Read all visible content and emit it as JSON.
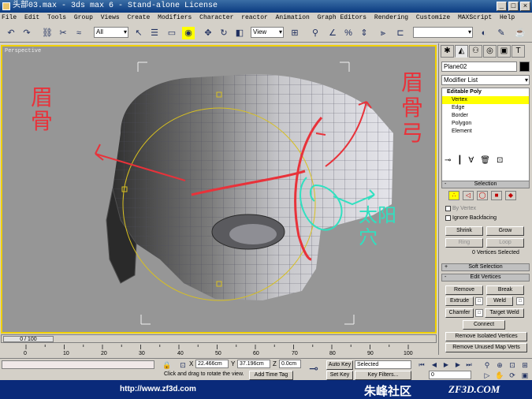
{
  "window": {
    "title": "头部03.max - 3ds max 6 - Stand-alone License"
  },
  "menu": [
    "File",
    "Edit",
    "Tools",
    "Group",
    "Views",
    "Create",
    "Modifiers",
    "Character",
    "reactor",
    "Animation",
    "Graph Editors",
    "Rendering",
    "Customize",
    "MAXScript",
    "Help"
  ],
  "toolbar": {
    "filter_value": "All",
    "view_value": "View"
  },
  "viewport": {
    "label": "Perspective",
    "annotations": {
      "brow_bone": "眉骨",
      "brow_ridge": "眉骨弓",
      "temple": "太阳穴"
    }
  },
  "command_panel": {
    "object_name": "Plane02",
    "modifier_list": "Modifier List",
    "stack": [
      "Editable Poly",
      "Vertex",
      "Edge",
      "Border",
      "Polygon",
      "Element"
    ],
    "selection": {
      "title": "Selection",
      "by_vertex": "By Vertex",
      "ignore_backfacing": "Ignore Backfacing",
      "shrink": "Shrink",
      "grow": "Grow",
      "ring": "Ring",
      "loop": "Loop",
      "status": "0 Vertices Selected"
    },
    "soft_selection": "Soft Selection",
    "edit_vertices": {
      "title": "Edit Vertices",
      "remove": "Remove",
      "break": "Break",
      "extrude": "Extrude",
      "weld": "Weld",
      "chamfer": "Chamfer",
      "target_weld": "Target Weld",
      "connect": "Connect",
      "remove_isolated": "Remove Isolated Vertices",
      "remove_unused": "Remove Unused Map Verts"
    }
  },
  "timeline": {
    "frame": "0 / 100",
    "ticks": [
      "0",
      "10",
      "20",
      "30",
      "40",
      "50",
      "60",
      "70",
      "80",
      "90",
      "100"
    ]
  },
  "status": {
    "x_label": "X",
    "x": "22.466cm",
    "y_label": "Y",
    "y": "37.196cm",
    "z_label": "Z",
    "z": "0.0cm",
    "prompt": "Click and drag to rotate the view.",
    "add_time_tag": "Add Time Tag",
    "auto_key": "Auto Key",
    "selected": "Selected",
    "set_key": "Set Key",
    "key_filters": "Key Filters...",
    "frame_field": "0"
  },
  "footer": {
    "url": "http://www.zf3d.com",
    "site_name": "朱峰社区",
    "brand": "ZF3D.COM"
  },
  "colors": {
    "viewport_bg": "#969696",
    "active_border": "#f0d000",
    "annotation_red": "#e8323a",
    "annotation_cyan": "#30e0c0",
    "footer_bg": "#0a2a7a"
  }
}
